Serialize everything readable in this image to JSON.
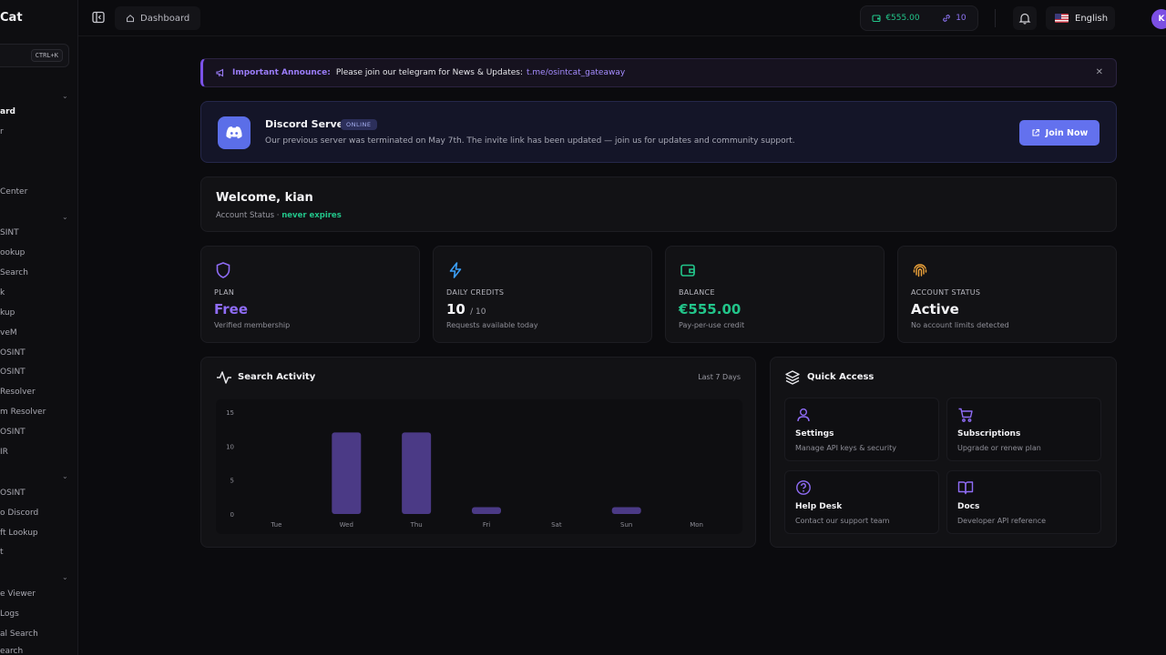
{
  "sidebar": {
    "brand": "Cat",
    "search_shortcut": "CTRL+K",
    "items": [
      {
        "label": "ard",
        "active": true
      },
      {
        "label": "r"
      },
      {
        "label": "Center"
      },
      {
        "label": "SINT"
      },
      {
        "label": "ookup"
      },
      {
        "label": "Search"
      },
      {
        "label": "k"
      },
      {
        "label": "kup"
      },
      {
        "label": "veM"
      },
      {
        "label": "OSINT"
      },
      {
        "label": "OSINT"
      },
      {
        "label": "Resolver"
      },
      {
        "label": "m Resolver"
      },
      {
        "label": "OSINT"
      },
      {
        "label": "IR"
      },
      {
        "label": "OSINT"
      },
      {
        "label": "o Discord"
      },
      {
        "label": "ft Lookup"
      },
      {
        "label": "t"
      },
      {
        "label": "e Viewer"
      },
      {
        "label": "Logs"
      },
      {
        "label": "al Search"
      },
      {
        "label": "earch"
      }
    ]
  },
  "topbar": {
    "breadcrumb": "Dashboard",
    "balance": "€555.00",
    "credits": "10",
    "language": "English",
    "avatar_initial": "K"
  },
  "announcement": {
    "tag": "Important Announce:",
    "message": "Please join our telegram for News & Updates:",
    "link": "t.me/osintcat_gateaway",
    "close": "✕"
  },
  "discord": {
    "title": "Discord Server",
    "badge": "ONLINE",
    "description": "Our previous server was terminated on May 7th. The invite link has been updated — join us for updates and community support.",
    "button": "Join Now",
    "color": "#5b6ee8"
  },
  "welcome": {
    "title": "Welcome, kian",
    "status_label": "Account Status ·",
    "status_value": "never expires"
  },
  "stats": [
    {
      "label": "PLAN",
      "value": "Free",
      "sub": "Verified membership",
      "icon": "shield-icon",
      "color": "#8f6cf6"
    },
    {
      "label": "DAILY CREDITS",
      "value": "10",
      "suffix": "/ 10",
      "sub": "Requests available today",
      "icon": "lightning-icon",
      "color": "#3b9ef5"
    },
    {
      "label": "BALANCE",
      "value": "€555.00",
      "sub": "Pay-per-use credit",
      "icon": "wallet-icon",
      "color": "#22c58a"
    },
    {
      "label": "ACCOUNT STATUS",
      "value": "Active",
      "sub": "No account limits detected",
      "icon": "fingerprint-icon",
      "color": "#f0a43a"
    }
  ],
  "activity": {
    "title": "Search Activity",
    "range": "Last 7 Days"
  },
  "chart_data": {
    "type": "bar",
    "categories": [
      "Tue",
      "Wed",
      "Thu",
      "Fri",
      "Sat",
      "Sun",
      "Mon"
    ],
    "values": [
      0,
      12,
      12,
      1,
      0,
      1,
      0
    ],
    "yticks": [
      0,
      5,
      10,
      15
    ],
    "ylim": [
      0,
      15
    ],
    "grid": false,
    "color": "#4b3a86"
  },
  "quick_access": {
    "title": "Quick Access",
    "items": [
      {
        "title": "Settings",
        "sub": "Manage API keys & security",
        "icon": "user-icon"
      },
      {
        "title": "Subscriptions",
        "sub": "Upgrade or renew plan",
        "icon": "cart-icon"
      },
      {
        "title": "Help Desk",
        "sub": "Contact our support team",
        "icon": "help-icon"
      },
      {
        "title": "Docs",
        "sub": "Developer API reference",
        "icon": "book-icon"
      }
    ]
  }
}
